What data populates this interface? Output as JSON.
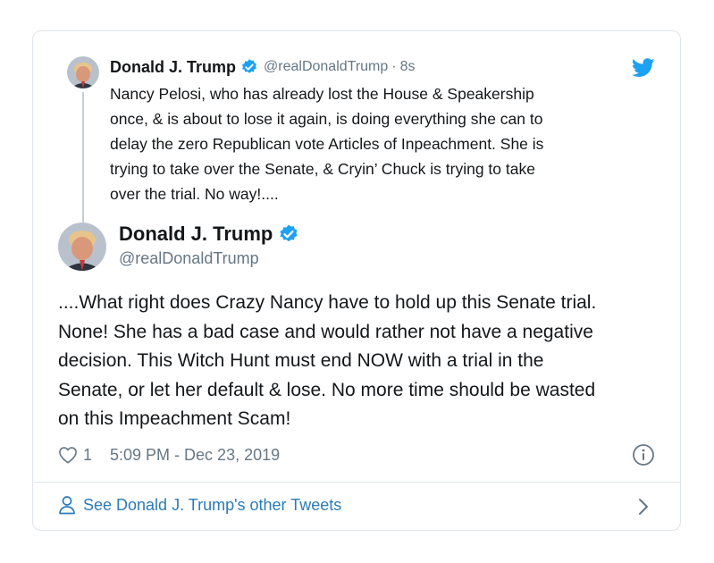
{
  "colors": {
    "verified": "#1da1f2",
    "link": "#2b7bb9",
    "muted": "#657786",
    "text": "#14171a",
    "border": "#dfe4e8"
  },
  "quoted": {
    "name": "Donald J. Trump",
    "handle": "@realDonaldTrump",
    "separator": "·",
    "time": "8s",
    "text": "Nancy Pelosi, who has already lost the House & Speakership\nonce, & is about to lose it again, is doing everything she can to\ndelay the zero Republican vote Articles of Inpeachment. She is\ntrying to take over the Senate, & Cryin’ Chuck is trying to take\nover the trial. No way!....",
    "icons": {
      "verified": "verified-badge-icon",
      "brand": "twitter-bird-icon"
    }
  },
  "tweet": {
    "name": "Donald J. Trump",
    "handle": "@realDonaldTrump",
    "text": "....What right does Crazy Nancy have to hold up this Senate trial.\nNone! She has a bad case and would rather not have a negative\ndecision. This Witch Hunt must end NOW with a trial in the\nSenate, or let her default & lose. No more time should be wasted\non this Impeachment Scam!",
    "like_count": "1",
    "timestamp": "5:09 PM - Dec 23, 2019",
    "icons": {
      "like": "heart-icon",
      "info": "info-icon"
    }
  },
  "footer": {
    "link_label": "See Donald J. Trump's other Tweets",
    "icons": {
      "person": "person-icon",
      "chevron": "chevron-right-icon"
    }
  }
}
